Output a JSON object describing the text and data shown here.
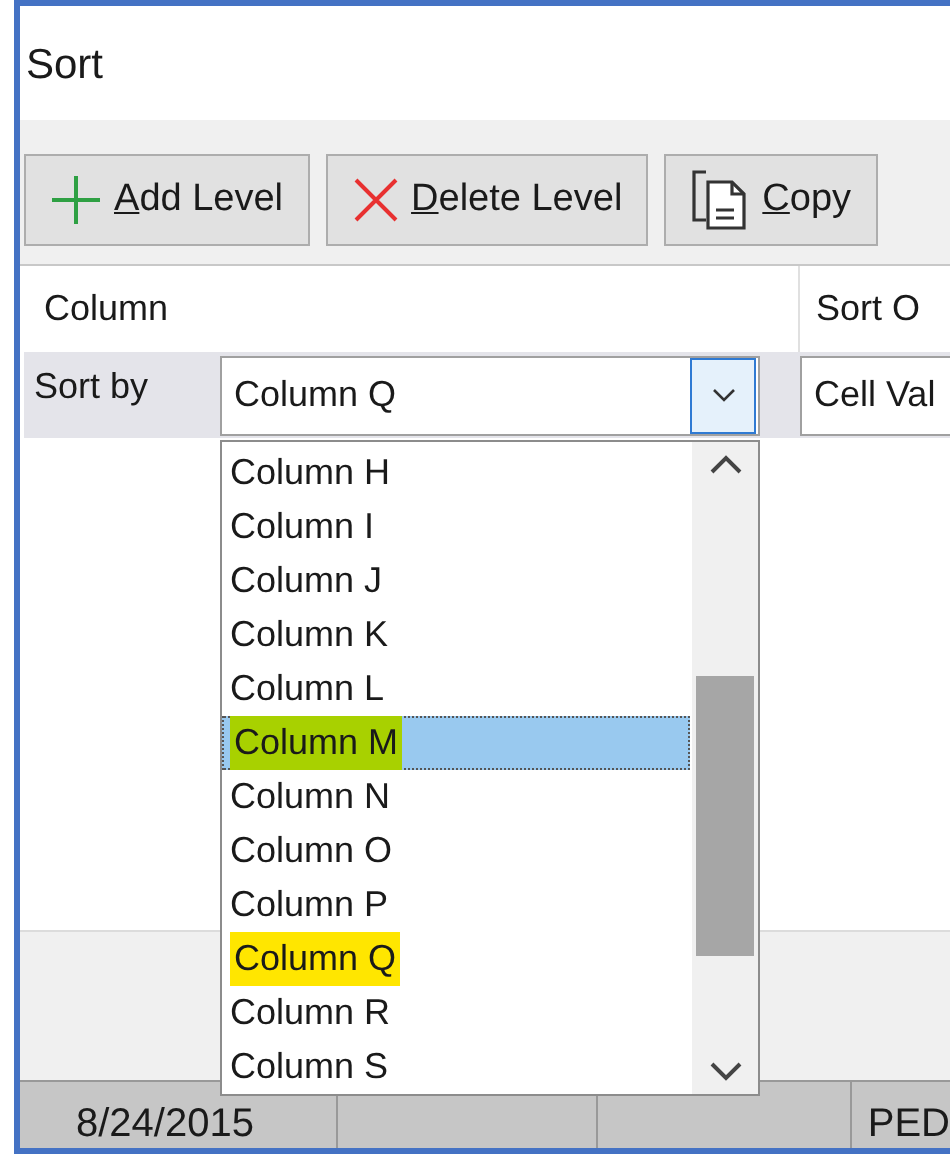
{
  "window": {
    "title": "Sort"
  },
  "toolbar": [
    {
      "label": "Add Level",
      "kind": "add"
    },
    {
      "label": "Delete Level",
      "kind": "delete"
    },
    {
      "label": "Copy",
      "kind": "copy"
    }
  ],
  "grid": {
    "columns": [
      "Column",
      "Sort O"
    ],
    "row": {
      "label": "Sort by",
      "column_value": "Column Q",
      "sort_on_value": "Cell Val"
    }
  },
  "dropdown": {
    "items": [
      {
        "label": "Column H",
        "selected": false
      },
      {
        "label": "Column I",
        "selected": false
      },
      {
        "label": "Column J",
        "selected": false
      },
      {
        "label": "Column K",
        "selected": false
      },
      {
        "label": "Column L",
        "selected": false
      },
      {
        "label": "Column M",
        "selected": true,
        "color": "#a8d100"
      },
      {
        "label": "Column N",
        "selected": false
      },
      {
        "label": "Column O",
        "selected": false
      },
      {
        "label": "Column P",
        "selected": false
      },
      {
        "label": "Column Q",
        "selected": false,
        "color": "#ffe600"
      },
      {
        "label": "Column R",
        "selected": false
      },
      {
        "label": "Column S",
        "selected": false
      }
    ]
  },
  "sheet_row": {
    "cells": [
      "8/24/2015",
      "PED"
    ]
  }
}
